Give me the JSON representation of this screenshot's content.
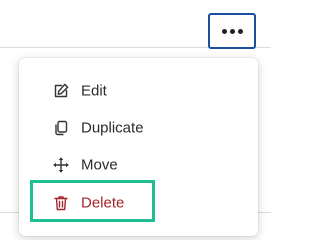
{
  "toolbar": {
    "more_button": {
      "icon": "more-horizontal-icon",
      "border_color": "#1a4f9e"
    }
  },
  "menu": {
    "items": [
      {
        "label": "Edit",
        "icon": "edit-icon"
      },
      {
        "label": "Duplicate",
        "icon": "duplicate-icon"
      },
      {
        "label": "Move",
        "icon": "move-icon"
      },
      {
        "label": "Delete",
        "icon": "trash-icon",
        "color": "#a4262c"
      }
    ],
    "highlight_color": "#1fbf95"
  }
}
